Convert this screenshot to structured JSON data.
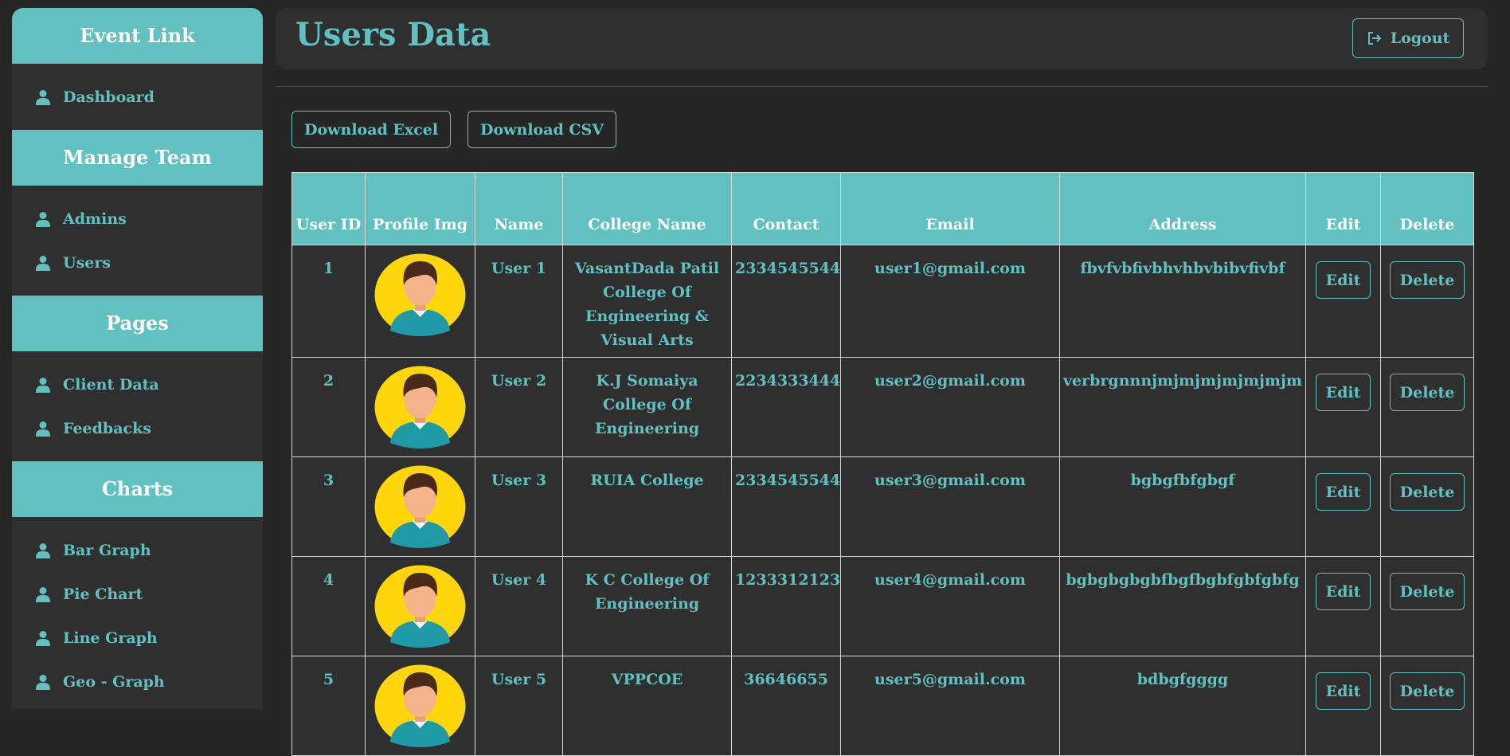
{
  "sidebar": {
    "brand": "Event Link",
    "main": [
      {
        "label": "Dashboard",
        "icon": "user-icon"
      }
    ],
    "sections": [
      {
        "title": "Manage Team",
        "items": [
          {
            "label": "Admins",
            "icon": "user-icon"
          },
          {
            "label": "Users",
            "icon": "user-icon"
          }
        ]
      },
      {
        "title": "Pages",
        "items": [
          {
            "label": "Client Data",
            "icon": "user-icon"
          },
          {
            "label": "Feedbacks",
            "icon": "user-icon"
          }
        ]
      },
      {
        "title": "Charts",
        "items": [
          {
            "label": "Bar Graph",
            "icon": "user-icon"
          },
          {
            "label": "Pie Chart",
            "icon": "user-icon"
          },
          {
            "label": "Line Graph",
            "icon": "user-icon"
          },
          {
            "label": "Geo - Graph",
            "icon": "user-icon"
          }
        ]
      }
    ]
  },
  "header": {
    "title": "Users Data",
    "logout_label": "Logout",
    "logout_icon": "logout-icon"
  },
  "toolbar": {
    "download_excel": "Download Excel",
    "download_csv": "Download CSV"
  },
  "table": {
    "columns": [
      "User ID",
      "Profile Img",
      "Name",
      "College Name",
      "Contact",
      "Email",
      "Address",
      "Edit",
      "Delete"
    ],
    "edit_label": "Edit",
    "delete_label": "Delete",
    "rows": [
      {
        "id": "1",
        "name": "User 1",
        "college": "VasantDada Patil College Of Engineering & Visual Arts",
        "contact": "2334545544",
        "email": "user1@gmail.com",
        "address": "fbvfvbfivbhvhbvbibvfivbf"
      },
      {
        "id": "2",
        "name": "User 2",
        "college": "K.J Somaiya College Of Engineering",
        "contact": "2234333444",
        "email": "user2@gmail.com",
        "address": "verbrgnnnjmjmjmjmjmjmjm"
      },
      {
        "id": "3",
        "name": "User 3",
        "college": "RUIA College",
        "contact": "2334545544",
        "email": "user3@gmail.com",
        "address": "bgbgfbfgbgf"
      },
      {
        "id": "4",
        "name": "User 4",
        "college": "K C College Of Engineering",
        "contact": "1233312123",
        "email": "user4@gmail.com",
        "address": "bgbgbgbgbfbgfbgbfgbfgbfg"
      },
      {
        "id": "5",
        "name": "User 5",
        "college": "VPPCOE",
        "contact": "36646655",
        "email": "user5@gmail.com",
        "address": "bdbgfgggg"
      }
    ]
  },
  "colors": {
    "accent": "#62c0c0",
    "background": "#262626",
    "panel": "#2f2f2f",
    "avatar_bg": "#ffd60a"
  }
}
